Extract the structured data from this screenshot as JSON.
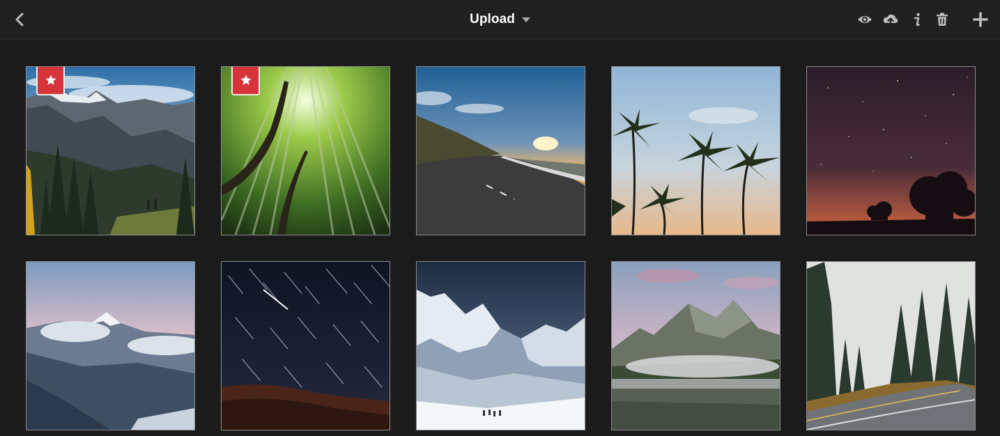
{
  "header": {
    "title": "Upload"
  },
  "toolbar": {
    "icons": [
      "back-icon",
      "dropdown-caret-icon",
      "eye-icon",
      "cloud-upload-icon",
      "info-icon",
      "trash-icon",
      "plus-icon"
    ]
  },
  "grid": {
    "items": [
      {
        "favorite": true,
        "scene": "mountain-valley-hikers"
      },
      {
        "favorite": true,
        "scene": "bamboo-forest"
      },
      {
        "favorite": false,
        "scene": "road-sunset"
      },
      {
        "favorite": false,
        "scene": "palm-trees-sky"
      },
      {
        "favorite": false,
        "scene": "starry-night-trees"
      },
      {
        "favorite": false,
        "scene": "snowy-peak-clouds"
      },
      {
        "favorite": false,
        "scene": "star-trails"
      },
      {
        "favorite": false,
        "scene": "snowy-mountains"
      },
      {
        "favorite": false,
        "scene": "mountain-lake-fog"
      },
      {
        "favorite": false,
        "scene": "forest-road"
      }
    ]
  },
  "colors": {
    "background": "#1b1b1b",
    "topbar": "#202020",
    "favorite_badge": "#d6343a",
    "icon": "#bdbdbd"
  }
}
